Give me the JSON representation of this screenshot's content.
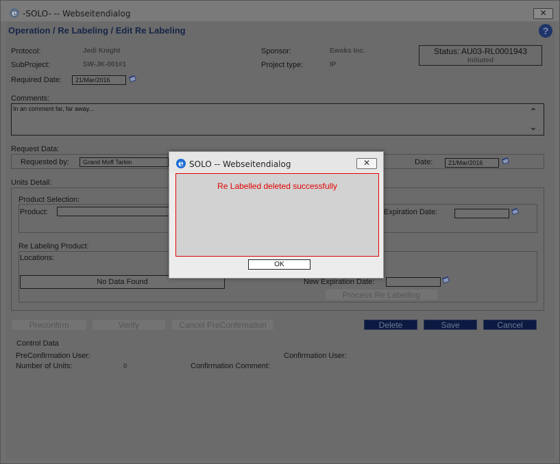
{
  "window": {
    "title": "-SOLO- -- Webseitendialog",
    "close_label": "✕"
  },
  "page": {
    "title": "Operation / Re Labeling / Edit Re Labeling",
    "help_label": "?"
  },
  "header": {
    "protocol_label": "Protocol:",
    "protocol_value": "Jedi Knight",
    "subproject_label": "SubProject:",
    "subproject_value": "SW-JK-001#1",
    "sponsor_label": "Sponsor:",
    "sponsor_value": "Ewoks Inc.",
    "project_type_label": "Project type:",
    "project_type_value": "IP",
    "status_line": "Status: AU03-RL0001943",
    "status_state": "Initiated",
    "required_date_label": "Required Date:",
    "required_date_value": "21/Mar/2016"
  },
  "comments": {
    "label": "Comments:",
    "value": "In an comment far, far away..."
  },
  "request": {
    "section_label": "Request Data:",
    "requested_by_label": "Requested by:",
    "requested_by_value": "Grand Moff Tarkin",
    "date_label": "Date:",
    "date_value": "21/Mar/2016"
  },
  "units": {
    "section_label": "Units Detail:",
    "product_selection_label": "Product Selection:",
    "product_label": "Product:",
    "product_value": "",
    "expiration_label": "Expiration Date:",
    "expiration_value": "",
    "relabel_product_label": "Re Labeling Product:",
    "locations_label": "Locations:",
    "no_data": "No Data Found",
    "new_expiration_label": "New Expiration Date:",
    "new_expiration_value": "",
    "process_button": "Process Re Labelling"
  },
  "actions": {
    "preconfirm": "Preconfirm",
    "verify": "Verify",
    "cancel_preconfirmation": "Cancel PreConfirmation",
    "delete": "Delete",
    "save": "Save",
    "cancel": "Cancel"
  },
  "control": {
    "section_label": "Control Data",
    "preconf_user_label": "PreConfirmation User:",
    "conf_user_label": "Confirmation User:",
    "num_units_label": "Number of Units:",
    "num_units_value": "0",
    "conf_comment_label": "Confirmation Comment:"
  },
  "dialog": {
    "title": "SOLO -- Webseitendialog",
    "close_label": "✕",
    "message": "Re Labelled deleted successfully",
    "ok_label": "OK"
  },
  "colors": {
    "message_red": "#e20000",
    "navy_button": "#0c1a41",
    "title_navy": "#152548"
  }
}
